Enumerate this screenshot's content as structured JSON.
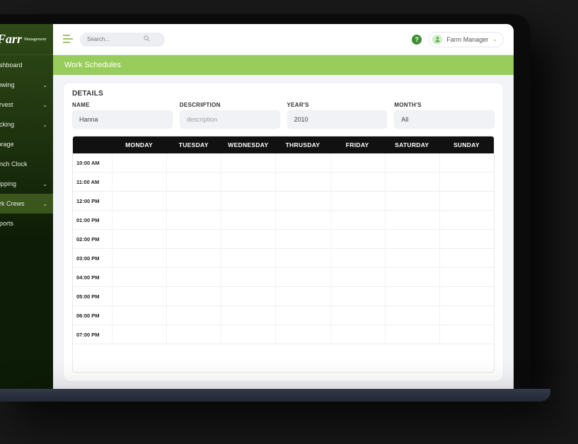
{
  "brand": {
    "name": "Farr",
    "sub": "Management"
  },
  "sidebar": {
    "items": [
      {
        "label": "ashboard",
        "expandable": false
      },
      {
        "label": "rowing",
        "expandable": true
      },
      {
        "label": "arvest",
        "expandable": true
      },
      {
        "label": "acking",
        "expandable": true
      },
      {
        "label": "torage",
        "expandable": false
      },
      {
        "label": "unch Clock",
        "expandable": false
      },
      {
        "label": "hipping",
        "expandable": true
      },
      {
        "label": "ork Crews",
        "expandable": true,
        "active": true
      },
      {
        "label": "eports",
        "expandable": false
      }
    ]
  },
  "topbar": {
    "search_placeholder": "Search...",
    "user_label": "Farm Manager"
  },
  "pagebar": {
    "title": "Work Schedules"
  },
  "details": {
    "section_title": "DETAILS",
    "fields": {
      "name": {
        "label": "NAME",
        "value": "Hanna"
      },
      "description": {
        "label": "DESCRIPTION",
        "value": "description"
      },
      "year": {
        "label": "YEAR'S",
        "value": "2010"
      },
      "month": {
        "label": "MONTH'S",
        "value": "All"
      }
    }
  },
  "schedule": {
    "days": [
      "MONDAY",
      "TUESDAY",
      "WEDNESDAY",
      "THRUSDAY",
      "FRIDAY",
      "SATURDAY",
      "SUNDAY"
    ],
    "times": [
      "10:00 AM",
      "11:00 AM",
      "12:00 PM",
      "01:00 PM",
      "02:00 PM",
      "03:00 PM",
      "04:00 PM",
      "05:00 PM",
      "06:00 PM",
      "07:00 PM"
    ]
  }
}
